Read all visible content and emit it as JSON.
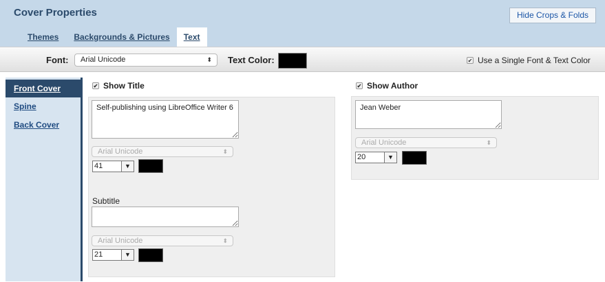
{
  "header": {
    "title": "Cover Properties",
    "hide_button": "Hide Crops & Folds",
    "tabs": [
      {
        "label": "Themes"
      },
      {
        "label": "Backgrounds & Pictures"
      },
      {
        "label": "Text"
      }
    ],
    "active_tab": "Text",
    "background_color": "#c5d8e9"
  },
  "toolbar": {
    "font_label": "Font:",
    "font_value": "Arial Unicode",
    "text_color_label": "Text Color:",
    "text_color": "#000000",
    "single_font_label": "Use a Single Font & Text Color",
    "single_font_checked": true
  },
  "sidenav": {
    "items": [
      {
        "label": "Front Cover"
      },
      {
        "label": "Spine"
      },
      {
        "label": "Back Cover"
      }
    ],
    "active": "Front Cover",
    "accent": "#2b4a6b"
  },
  "front_cover": {
    "show_title_label": "Show Title",
    "show_title_checked": true,
    "title_text": "Self-publishing using LibreOffice Writer 6",
    "title_font": "Arial Unicode",
    "title_size": "41",
    "title_color": "#000000",
    "subtitle_label": "Subtitle",
    "subtitle_text": "",
    "subtitle_font": "Arial Unicode",
    "subtitle_size": "21",
    "subtitle_color": "#000000",
    "show_author_label": "Show Author",
    "show_author_checked": true,
    "author_text": "Jean Weber",
    "author_font": "Arial Unicode",
    "author_size": "20",
    "author_color": "#000000"
  },
  "icons": {
    "checkmark": "✔",
    "dropdown_arrow": "▼",
    "select_chevron": "⬍"
  }
}
